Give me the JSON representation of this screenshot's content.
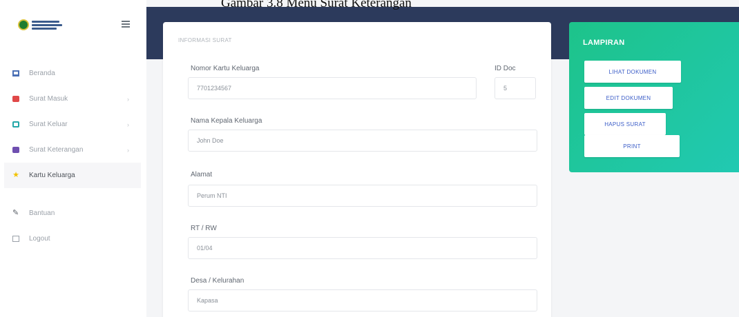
{
  "caption": "Gambar 3.8  Menu Surat Keterangan",
  "sidebar": {
    "items": [
      {
        "label": "Beranda",
        "icon": "monitor-icon"
      },
      {
        "label": "Surat Masuk",
        "icon": "inbox-icon"
      },
      {
        "label": "Surat Keluar",
        "icon": "outbox-icon"
      },
      {
        "label": "Surat Keterangan",
        "icon": "document-icon"
      },
      {
        "label": "Kartu Keluarga",
        "icon": "star-icon"
      },
      {
        "label": "Bantuan",
        "icon": "help-icon"
      },
      {
        "label": "Logout",
        "icon": "logout-icon"
      }
    ],
    "chevron": "›"
  },
  "form": {
    "title": "INFORMASI SURAT",
    "fields": {
      "no_kk": {
        "label": "Nomor Kartu Keluarga",
        "value": "7701234567"
      },
      "id_doc": {
        "label": "ID Doc",
        "value": "5"
      },
      "nama": {
        "label": "Nama Kepala Keluarga",
        "value": "John Doe"
      },
      "alamat": {
        "label": "Alamat",
        "value": "Perum NTI"
      },
      "rtrw": {
        "label": "RT / RW",
        "value": "01/04"
      },
      "desa": {
        "label": "Desa / Kelurahan",
        "value": "Kapasa"
      }
    }
  },
  "lampiran": {
    "title": "LAMPIRAN",
    "buttons": {
      "lihat": "LIHAT DOKUMEN",
      "edit": "EDIT DOKUMEN",
      "hapus": "HAPUS SURAT",
      "print": "PRINT"
    }
  },
  "colors": {
    "topbar": "#2c3a5c",
    "accent": "#1dc38a",
    "button_text": "#3a5cc7"
  }
}
